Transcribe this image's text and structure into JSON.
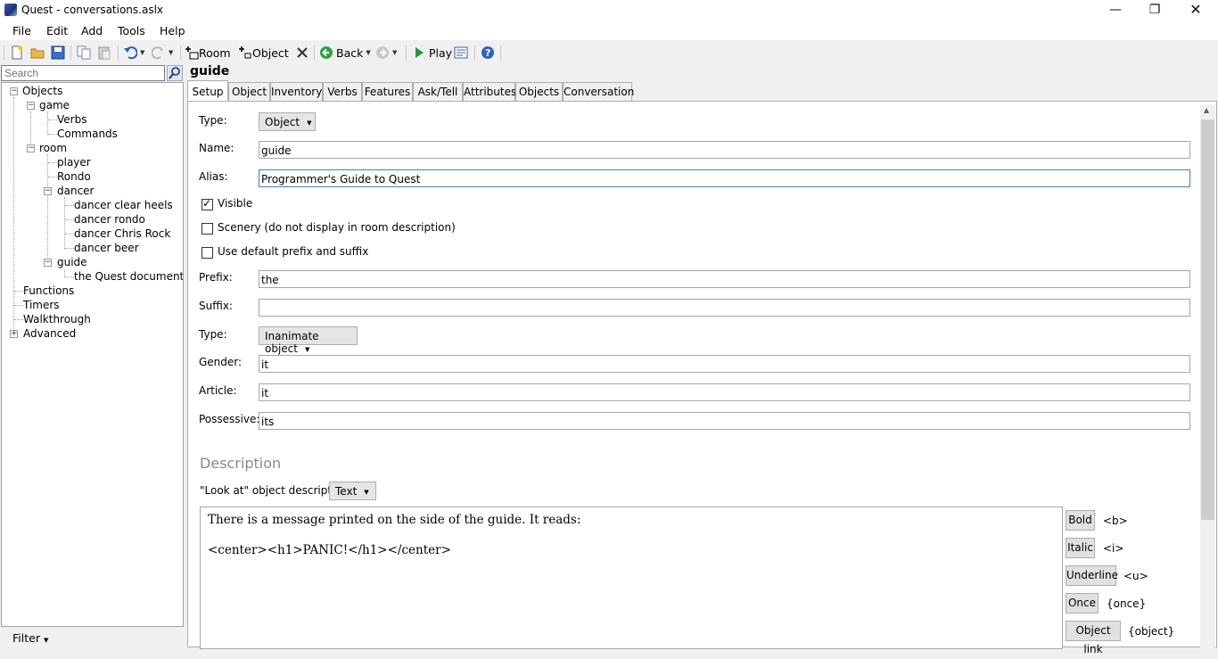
{
  "window": {
    "title": "Quest - conversations.aslx"
  },
  "menu": [
    "File",
    "Edit",
    "Add",
    "Tools",
    "Help"
  ],
  "toolbar": {
    "room": "Room",
    "object": "Object",
    "back": "Back",
    "play": "Play"
  },
  "search": {
    "placeholder": "Search"
  },
  "tree": {
    "objects": "Objects",
    "game": "game",
    "verbs": "Verbs",
    "commands": "Commands",
    "room": "room",
    "player": "player",
    "rondo": "Rondo",
    "dancer": "dancer",
    "dancer_clear_heels": "dancer clear heels",
    "dancer_rondo": "dancer rondo",
    "dancer_chris_rock": "dancer Chris Rock",
    "dancer_beer": "dancer beer",
    "guide": "guide",
    "quest_doc": "the Quest documentation",
    "functions": "Functions",
    "timers": "Timers",
    "walkthrough": "Walkthrough",
    "advanced": "Advanced"
  },
  "filter": {
    "label": "Filter"
  },
  "object_title": "guide",
  "tabs": [
    "Setup",
    "Object",
    "Inventory",
    "Verbs",
    "Features",
    "Ask/Tell",
    "Attributes",
    "Objects",
    "Conversation"
  ],
  "setup": {
    "type_label": "Type:",
    "type_value": "Object",
    "name_label": "Name:",
    "name_value": "guide",
    "alias_label": "Alias:",
    "alias_value": "Programmer's Guide to Quest",
    "visible_label": "Visible",
    "visible_checked": true,
    "scenery_label": "Scenery (do not display in room description)",
    "scenery_checked": false,
    "prefix_suffix_label": "Use default prefix and suffix",
    "prefix_suffix_checked": false,
    "prefix_label": "Prefix:",
    "prefix_value": "the",
    "suffix_label": "Suffix:",
    "suffix_value": "",
    "type2_label": "Type:",
    "type2_value": "Inanimate object",
    "gender_label": "Gender:",
    "gender_value": "it",
    "article_label": "Article:",
    "article_value": "it",
    "possessive_label": "Possessive:",
    "possessive_value": "its"
  },
  "description": {
    "title": "Description",
    "look_at_label": "\"Look at\" object description:",
    "look_at_type": "Text",
    "line1": "There is a message printed on the side of the guide.  It reads:",
    "line2": "<center><h1>PANIC!</h1></center>"
  },
  "format_buttons": [
    {
      "label": "Bold",
      "tag": "<b>"
    },
    {
      "label": "Italic",
      "tag": "<i>"
    },
    {
      "label": "Underline",
      "tag": "<u>"
    },
    {
      "label": "Once",
      "tag": "{once}"
    },
    {
      "label": "Object link",
      "tag": "{object}"
    }
  ]
}
